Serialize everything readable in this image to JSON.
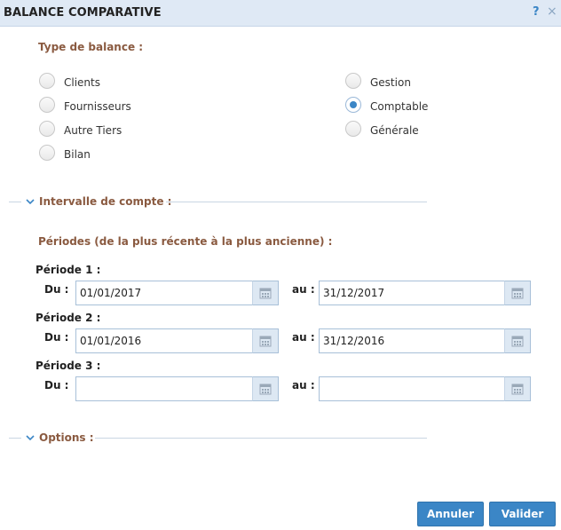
{
  "window": {
    "title": "BALANCE COMPARATIVE",
    "help_label": "?",
    "close_label": "×"
  },
  "balance_type": {
    "label": "Type de balance :",
    "options": [
      "Clients",
      "Fournisseurs",
      "Autre Tiers",
      "Bilan",
      "Gestion",
      "Comptable",
      "Générale"
    ],
    "selected": "Comptable"
  },
  "intervalle": {
    "label": "Intervalle de compte :"
  },
  "periods": {
    "label": "Périodes (de la plus récente à la plus ancienne) :",
    "from_label": "Du :",
    "to_label": "au :",
    "items": [
      {
        "label": "Période 1 :",
        "from": "01/01/2017",
        "to": "31/12/2017"
      },
      {
        "label": "Période 2 :",
        "from": "01/01/2016",
        "to": "31/12/2016"
      },
      {
        "label": "Période 3 :",
        "from": "",
        "to": ""
      }
    ]
  },
  "options": {
    "label": "Options :"
  },
  "buttons": {
    "cancel": "Annuler",
    "validate": "Valider"
  },
  "colors": {
    "accent": "#3b86c6",
    "section_label": "#8a5a40",
    "titlebar": "#dfe9f5"
  }
}
